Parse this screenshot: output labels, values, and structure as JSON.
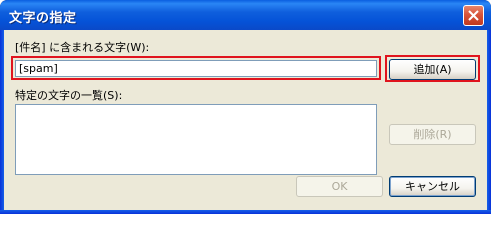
{
  "window": {
    "title": "文字の指定"
  },
  "input_section": {
    "label": "[件名] に含まれる文字(W):",
    "value": "[spam]"
  },
  "list_section": {
    "label": "特定の文字の一覧(S):",
    "items": []
  },
  "buttons": {
    "add": "追加(A)",
    "delete": "削除(R)",
    "ok": "OK",
    "cancel": "キャンセル"
  },
  "colors": {
    "highlight": "#e0141e",
    "titlebar": "#0553d8",
    "dialog_bg": "#ece9d8"
  },
  "icons": {
    "close": "close-icon"
  }
}
